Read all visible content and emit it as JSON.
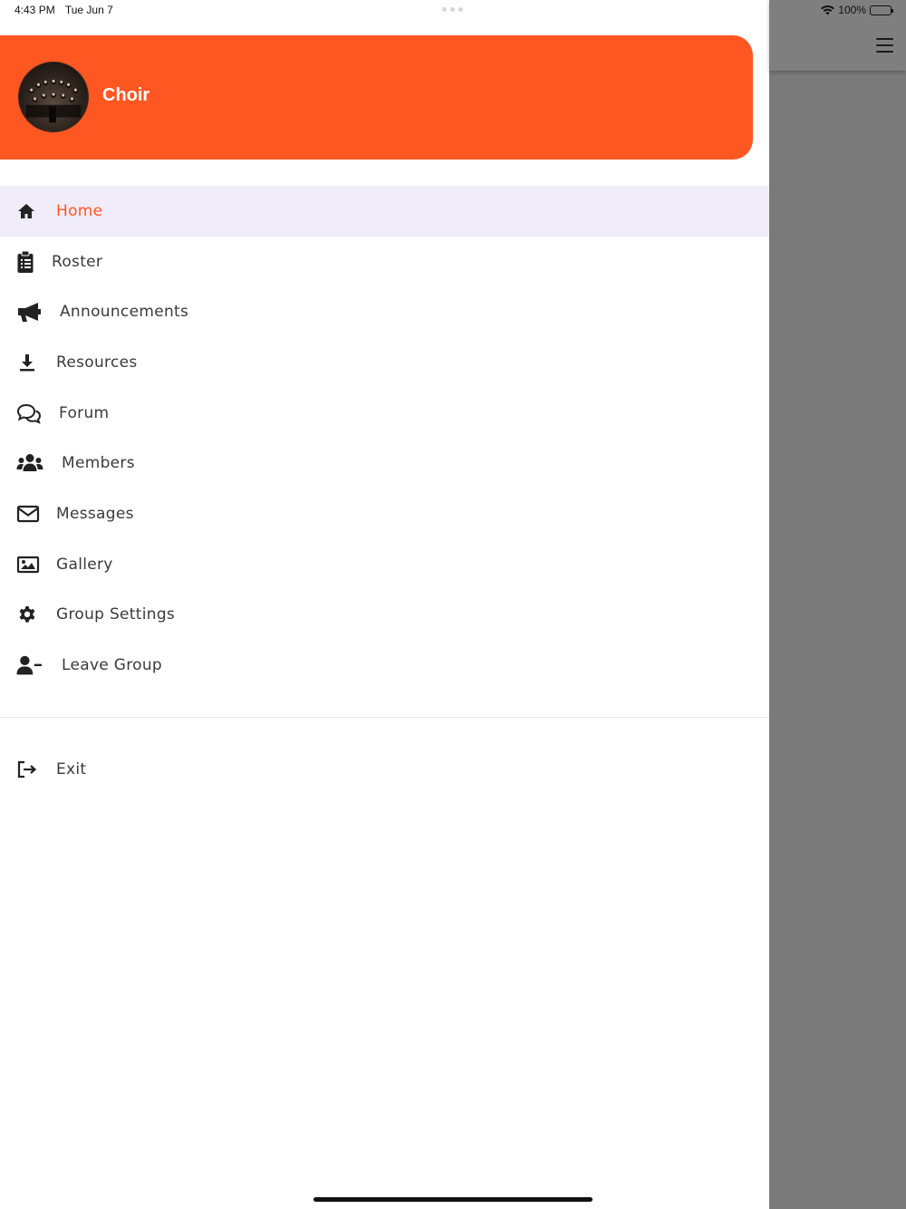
{
  "status_bar": {
    "time": "4:43 PM",
    "date": "Tue Jun 7",
    "battery": "100%"
  },
  "drawer": {
    "group_name": "Choir",
    "accent_color": "#ff5722",
    "active_bg_color": "#f1ecfa",
    "items": [
      {
        "label": "Home",
        "icon": "home-icon",
        "active": true
      },
      {
        "label": "Roster",
        "icon": "clipboard-list-icon"
      },
      {
        "label": "Announcements",
        "icon": "megaphone-icon"
      },
      {
        "label": "Resources",
        "icon": "download-icon"
      },
      {
        "label": "Forum",
        "icon": "chat-bubbles-icon"
      },
      {
        "label": "Members",
        "icon": "users-icon"
      },
      {
        "label": "Messages",
        "icon": "envelope-icon"
      },
      {
        "label": "Gallery",
        "icon": "image-icon"
      },
      {
        "label": "Group Settings",
        "icon": "gear-icon"
      },
      {
        "label": "Leave Group",
        "icon": "user-minus-icon"
      }
    ],
    "exit": {
      "label": "Exit",
      "icon": "sign-out-icon"
    }
  },
  "backdrop": {
    "menu_icon": "hamburger-menu-icon"
  }
}
